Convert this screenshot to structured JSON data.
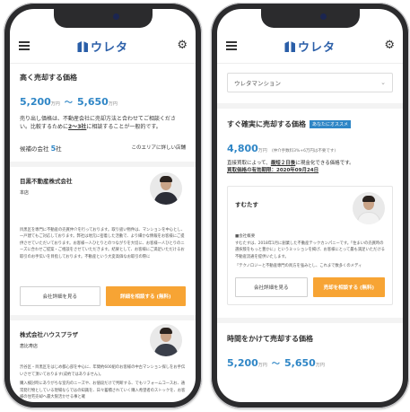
{
  "app": {
    "logo_text": "ウレタ"
  },
  "left": {
    "title": "高く売却する価格",
    "price_low": "5,200",
    "price_unit1": "万円",
    "sep": "〜",
    "price_high": "5,650",
    "price_unit2": "万円",
    "desc_pre": "売り出し価格は、不動産会社に売却方法と合わせてご相談ください。比較するために",
    "desc_link": "2〜3社",
    "desc_post": "に相談することが一般的です。",
    "candidates_label": "候補の会社",
    "candidates_count": "5",
    "candidates_unit": "社",
    "area_link": "このエリアに詳しい店舗",
    "company1": {
      "name": "目黒不動産株式会社",
      "branch": "本店",
      "desc": "目黒区を専門に不動産の売買仲介を行っております。取り扱い物件は、マンションを中心とし、一戸建てもご対応しております。弊社は地元に密着した活動で、より細かな情報をお客様にご提供させていただいております。お客様一人ひとりとのつながりを大切に、お客様一人ひとりのニーズに合わせご提案・ご相談をさせていただきます。結果として、お客様にご満足いただけるお取引のお手伝いを目指しております。不動産という大変高価なお取引の際に",
      "btn_detail": "会社詳細を見る",
      "btn_consult": "詳細を相談する (無料)"
    },
    "company2": {
      "name": "株式会社ハウスプラザ",
      "branch": "恵比寿店",
      "desc": "渋谷区・目黒区をはじめ都心部を中心に、年間約600組のお客様の中古マンション探しをお手伝いさせて頂いております(成約ではありません)。",
      "desc2": "購入検討時にありがちな室内のニーズや、お値段だけで判断する、でもリフォームコースお、通常発行物としている現場ならではの知識を、日々蓄積されていく購入希望者のストックを、お客様の住宅売却へ最大限活かせる事と確"
    }
  },
  "right": {
    "select_value": "ウレタマンション",
    "sure_title": "すぐ確実に売却する価格",
    "sure_badge": "あなたにオススメ",
    "sure_price": "4,800",
    "sure_unit": "万円",
    "sure_note": "(仲介手数料3%+6万円は不要です)",
    "sure_desc_pre": "直接買取によって、",
    "sure_desc_link": "最短２日後",
    "sure_desc_post": "に現金化できる価格です。",
    "deadline": "買取価格の有効期限：2020年09月24日",
    "company": {
      "name": "すむたす",
      "intro_label": "■会社概要",
      "desc": "すむたすは、2018年1月に創業した不動産テックカンパニーです。「住まいの売買時の選択肢をもっと豊かに」というミッションを掲げ、お客様にとって最も満足いただける不動産流通を提供いたします。",
      "desc2": "「テクノロジーと不動産専門の両方を強みとし、これまで数多くのメディ",
      "btn_detail": "会社詳細を見る",
      "btn_consult": "売却を相談する (無料)"
    },
    "slow_title": "時間をかけて売却する価格",
    "slow_price_low": "5,200",
    "slow_unit1": "万円",
    "slow_sep": "〜",
    "slow_price_high": "5,650",
    "slow_unit2": "万円"
  }
}
